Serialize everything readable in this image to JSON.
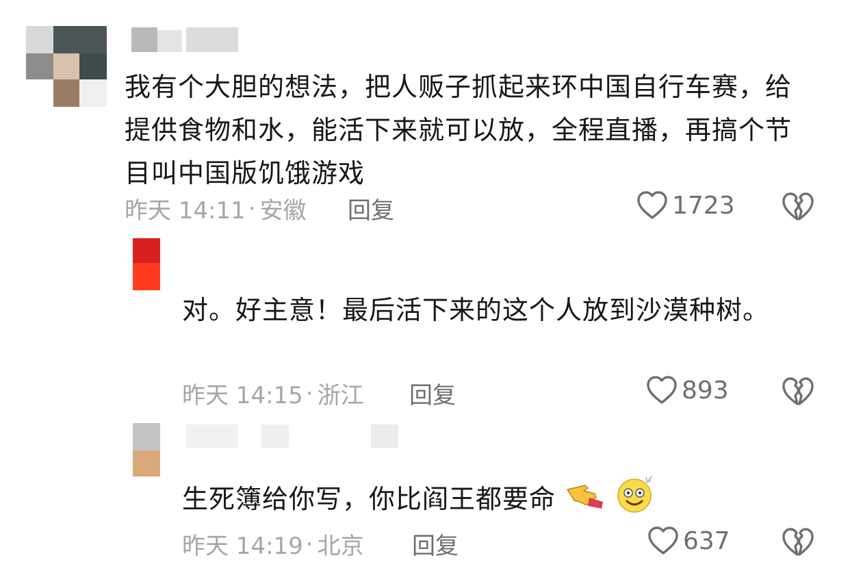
{
  "comments": [
    {
      "text": "我有个大胆的想法，把人贩子抓起来环中国自行车赛，给提供食物和水，能活下来就可以放，全程直播，再搞个节目叫中国版饥饿游戏",
      "time": "昨天 14:11",
      "location": "安徽",
      "reply_label": "回复",
      "likes": "1723"
    },
    {
      "text": "对。好主意！最后活下来的这个人放到沙漠种树。",
      "time": "昨天 14:15",
      "location": "浙江",
      "reply_label": "回复",
      "likes": "893"
    },
    {
      "text": "生死簿给你写，你比阎王都要命",
      "time": "昨天 14:19",
      "location": "北京",
      "reply_label": "回复",
      "likes": "637",
      "emojis": [
        "pointing-hand-emoji",
        "dizzy-face-emoji"
      ]
    }
  ],
  "colors": {
    "text": "#161616",
    "meta": "#a6a6a6",
    "action": "#6e6e6e"
  },
  "icons": {
    "like": "heart-outline-icon",
    "dislike": "broken-heart-icon"
  }
}
